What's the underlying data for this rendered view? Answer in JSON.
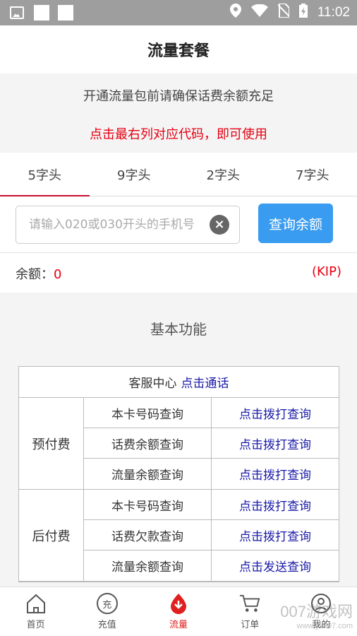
{
  "status_bar": {
    "time": "11:02"
  },
  "header": {
    "title": "流量套餐"
  },
  "notice": {
    "line1": "开通流量包前请确保话费余额充足",
    "line2": "点击最右列对应代码，即可使用"
  },
  "tabs": [
    {
      "label": "5字头",
      "active": true
    },
    {
      "label": "9字头",
      "active": false
    },
    {
      "label": "2字头",
      "active": false
    },
    {
      "label": "7字头",
      "active": false
    }
  ],
  "search": {
    "placeholder": "请输入020或030开头的手机号",
    "value": "",
    "button_label": "查询余额"
  },
  "balance": {
    "label": "余额：",
    "value": "0",
    "unit": "(KIP)"
  },
  "section": {
    "title": "基本功能"
  },
  "table": {
    "service_center": {
      "label": "客服中心",
      "link": "点击通话"
    },
    "groups": [
      {
        "name": "预付费",
        "rows": [
          {
            "name": "本卡号码查询",
            "action": "点击拨打查询"
          },
          {
            "name": "话费余额查询",
            "action": "点击拨打查询"
          },
          {
            "name": "流量余额查询",
            "action": "点击拨打查询"
          }
        ]
      },
      {
        "name": "后付费",
        "rows": [
          {
            "name": "本卡号码查询",
            "action": "点击拨打查询"
          },
          {
            "name": "话费欠款查询",
            "action": "点击拨打查询"
          },
          {
            "name": "流量余额查询",
            "action": "点击发送查询"
          }
        ]
      }
    ]
  },
  "bottom_nav": [
    {
      "label": "首页",
      "icon": "home-icon",
      "active": false
    },
    {
      "label": "充值",
      "icon": "recharge-icon",
      "icon_text": "充",
      "active": false
    },
    {
      "label": "流量",
      "icon": "traffic-icon",
      "active": true
    },
    {
      "label": "订单",
      "icon": "cart-icon",
      "active": false
    },
    {
      "label": "我的",
      "icon": "profile-icon",
      "active": false
    }
  ],
  "watermark": {
    "text": "007游戏网",
    "sub": "www.yx007.com"
  },
  "colors": {
    "accent_red": "#e60012",
    "button_blue": "#3a9cf0",
    "link_blue": "#1a1aa8"
  }
}
